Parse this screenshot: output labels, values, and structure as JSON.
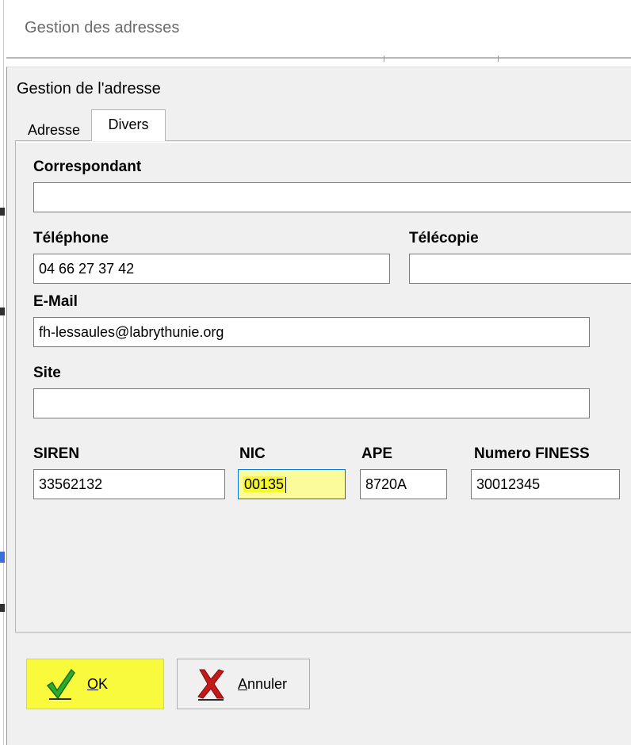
{
  "background_window": {
    "title": "Gestion des adresses"
  },
  "dialog": {
    "title": "Gestion de l'adresse",
    "tabs": [
      {
        "label": "Adresse",
        "active": false
      },
      {
        "label": "Divers",
        "active": true
      }
    ],
    "fields": {
      "correspondant": {
        "label": "Correspondant",
        "value": ""
      },
      "telephone": {
        "label": "Téléphone",
        "value": "04 66 27 37 42"
      },
      "telecopie": {
        "label": "Télécopie",
        "value": ""
      },
      "email": {
        "label": "E-Mail",
        "value": "fh-lessaules@labrythunie.org"
      },
      "site": {
        "label": "Site",
        "value": ""
      },
      "siren": {
        "label": "SIREN",
        "value": "33562132"
      },
      "nic": {
        "label": "NIC",
        "value": "00135"
      },
      "ape": {
        "label": "APE",
        "value": "8720A"
      },
      "finess": {
        "label": "Numero FINESS",
        "value": "30012345"
      }
    },
    "buttons": {
      "ok": {
        "label_underlined": "O",
        "label_rest": "K"
      },
      "cancel": {
        "label_underlined": "A",
        "label_rest": "nnuler"
      }
    }
  },
  "colors": {
    "highlight": "#f7f72d",
    "focus_border": "#0078d7",
    "dialog_bg": "#f0f0f0",
    "ok_check": "#2eaa2e",
    "cancel_x": "#c41a1a"
  },
  "icons": {
    "ok": "green-check-icon",
    "cancel": "red-x-icon"
  }
}
